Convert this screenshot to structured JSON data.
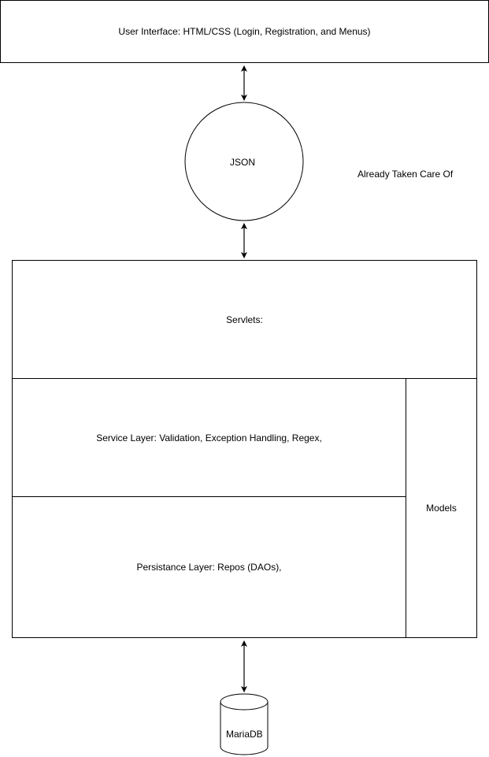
{
  "nodes": {
    "ui": "User Interface: HTML/CSS (Login, Registration, and Menus)",
    "json": "JSON",
    "servlets": "Servlets:",
    "service": "Service Layer: Validation, Exception Handling, Regex,",
    "persistence": "Persistance Layer: Repos (DAOs),",
    "models": "Models",
    "database": "MariaDB"
  },
  "annotations": {
    "already_taken_care_of": "Already Taken Care Of"
  },
  "colors": {
    "stroke": "#000000",
    "fill": "#ffffff"
  }
}
